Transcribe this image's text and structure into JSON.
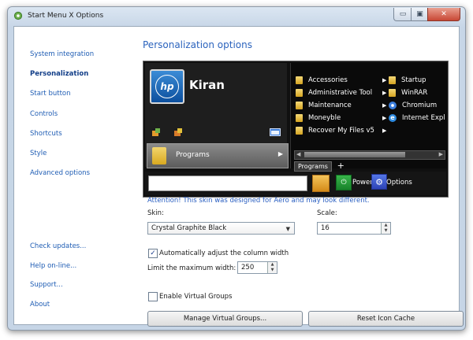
{
  "window": {
    "title": "Start Menu X Options",
    "close_glyph": "✕",
    "minimize_glyph": "▭",
    "maximize_glyph": "▣"
  },
  "nav": {
    "top_items": [
      "System integration",
      "Personalization",
      "Start button",
      "Controls",
      "Shortcuts",
      "Style",
      "Advanced options"
    ],
    "bottom_items": [
      "Check updates...",
      "Help on-line...",
      "Support...",
      "About"
    ],
    "active": "Personalization"
  },
  "page": {
    "heading": "Personalization options"
  },
  "preview": {
    "user_name": "Kiran",
    "logo_text": "hp",
    "programs_label": "Programs",
    "submenu_col1": [
      "Accessories",
      "Administrative Tool",
      "Maintenance",
      "Moneyble",
      "Recover My Files v5"
    ],
    "submenu_col2": [
      "Startup",
      "WinRAR",
      "Chromium",
      "Internet Expl"
    ],
    "tab_label": "Programs",
    "tab_add": "+",
    "power_label": "Power",
    "options_label": "Options"
  },
  "settings": {
    "attention": "Attention! This skin was designed for Aero and may look different.",
    "skin_label": "Skin:",
    "skin_value": "Crystal Graphite Black",
    "scale_label": "Scale:",
    "scale_value": "16",
    "auto_adjust_label": "Automatically adjust the column width",
    "auto_adjust_checked": true,
    "limit_label": "Limit the maximum width:",
    "limit_value": "250",
    "virtual_groups_label": "Enable Virtual Groups",
    "virtual_groups_checked": false
  },
  "buttons": {
    "manage_groups": "Manage Virtual Groups...",
    "reset_cache": "Reset Icon Cache"
  },
  "colors": {
    "link": "#1f5db4",
    "heading": "#2b63bd",
    "attention": "#2a5fc1",
    "preview_bg": "#101010"
  }
}
